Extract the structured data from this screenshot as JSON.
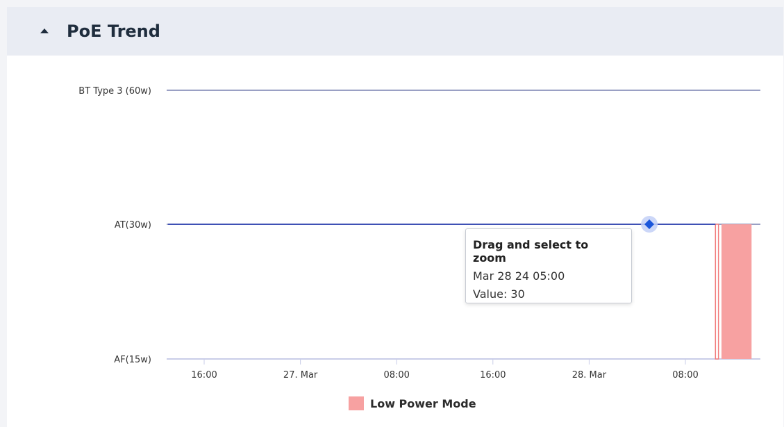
{
  "panel": {
    "title": "PoE Trend"
  },
  "tooltip": {
    "title": "Drag and select to zoom",
    "date": "Mar 28 24 05:00",
    "value_line": "Value: 30"
  },
  "colors": {
    "line": "#3f51b5",
    "marker": "#1a56db",
    "low_power": "#f7a1a1",
    "grid": "#9aa0c4"
  },
  "chart_data": {
    "type": "line",
    "y_categories": [
      "AF(15w)",
      "AT(30w)",
      "BT Type 3 (60w)"
    ],
    "x_ticks": [
      "16:00",
      "27. Mar",
      "08:00",
      "16:00",
      "28. Mar",
      "08:00"
    ],
    "x_tick_times": [
      "2024-03-26 16:00",
      "2024-03-27 00:00",
      "2024-03-27 08:00",
      "2024-03-27 16:00",
      "2024-03-28 00:00",
      "2024-03-28 08:00"
    ],
    "series": [
      {
        "values": [
          {
            "x": "2024-03-26 13:00",
            "y": "AT(30w)"
          },
          {
            "x": "2024-03-28 05:00",
            "y": "AT(30w)"
          },
          {
            "x": "2024-03-28 10:30",
            "y": "AT(30w)"
          }
        ]
      }
    ],
    "highlight_point": {
      "x": "2024-03-28 05:00",
      "y": "AT(30w)"
    },
    "low_power_mode": [
      {
        "start": "2024-03-28 10:30",
        "end": "2024-03-28 10:45",
        "style": "outline"
      },
      {
        "start": "2024-03-28 11:00",
        "end": "2024-03-28 13:30",
        "style": "filled"
      }
    ],
    "legend": [
      {
        "name": "Low Power Mode"
      }
    ],
    "legend_position": "bottom"
  }
}
